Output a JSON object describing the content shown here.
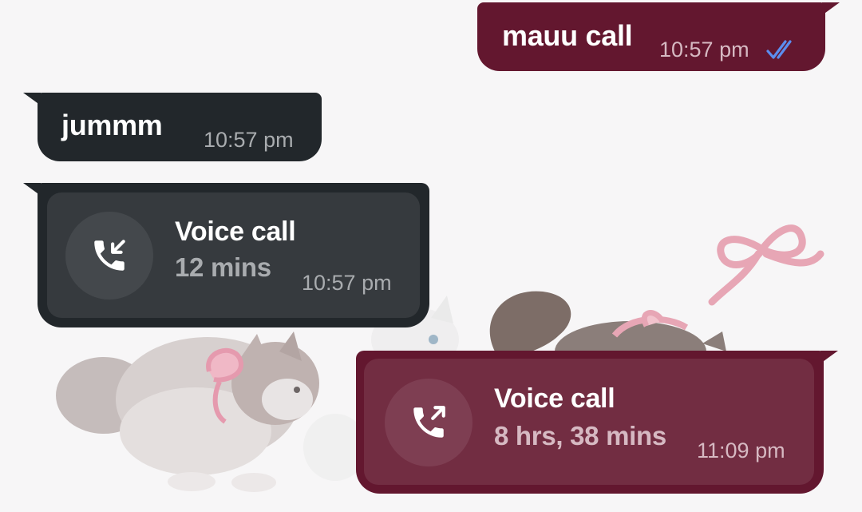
{
  "messages": [
    {
      "direction": "outgoing",
      "text": "mauu call",
      "time": "10:57 pm",
      "status_icon": "double-check-read-icon"
    },
    {
      "direction": "incoming",
      "text": "jummm",
      "time": "10:57 pm"
    },
    {
      "direction": "incoming",
      "type": "call",
      "call_icon": "incoming-call-icon",
      "title": "Voice call",
      "duration": "12 mins",
      "time": "10:57 pm"
    },
    {
      "direction": "outgoing",
      "type": "call",
      "call_icon": "outgoing-call-icon",
      "title": "Voice call",
      "duration": "8 hrs, 38 mins",
      "time": "11:09 pm"
    }
  ],
  "colors": {
    "outgoing_bubble": "#63172f",
    "incoming_bubble": "#22272b",
    "read_ticks": "#5b8def",
    "background": "#f7f6f7"
  }
}
